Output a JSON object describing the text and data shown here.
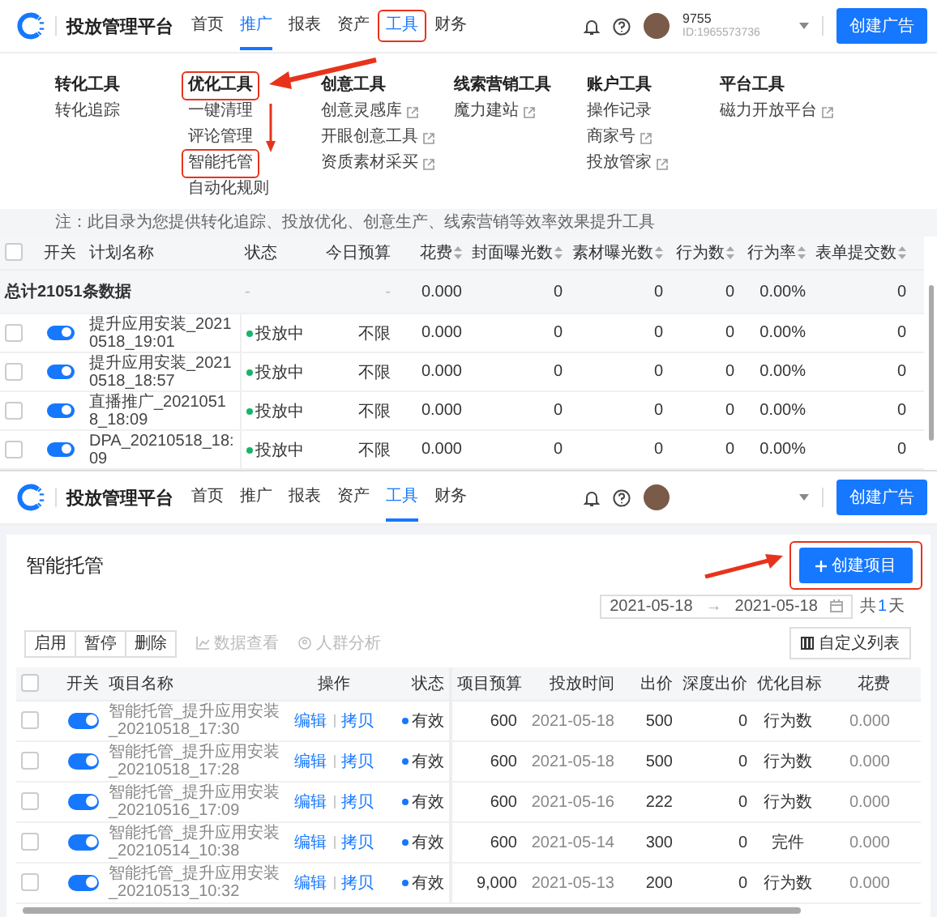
{
  "top_screen": {
    "nav": {
      "title": "投放管理平台",
      "tabs": [
        {
          "label": "首页",
          "selected": false,
          "highlighted": false
        },
        {
          "label": "推广",
          "selected": true,
          "highlighted": false
        },
        {
          "label": "报表",
          "selected": false,
          "highlighted": false
        },
        {
          "label": "资产",
          "selected": false,
          "highlighted": false
        },
        {
          "label": "工具",
          "selected": false,
          "highlighted": true
        },
        {
          "label": "财务",
          "selected": false,
          "highlighted": false
        }
      ],
      "user": {
        "name": "9755",
        "id": "ID:1965573736"
      },
      "create_button": "创建广告"
    },
    "menu": [
      {
        "heading": "转化工具",
        "highlighted": false,
        "items": [
          {
            "label": "转化追踪",
            "external": false,
            "highlighted": false
          }
        ]
      },
      {
        "heading": "优化工具",
        "highlighted": true,
        "items": [
          {
            "label": "一键清理",
            "external": false,
            "highlighted": false
          },
          {
            "label": "评论管理",
            "external": false,
            "highlighted": false
          },
          {
            "label": "智能托管",
            "external": false,
            "highlighted": true
          },
          {
            "label": "自动化规则",
            "external": false,
            "highlighted": false
          }
        ]
      },
      {
        "heading": "创意工具",
        "highlighted": false,
        "items": [
          {
            "label": "创意灵感库",
            "external": true,
            "highlighted": false
          },
          {
            "label": "开眼创意工具",
            "external": true,
            "highlighted": false
          },
          {
            "label": "资质素材采买",
            "external": true,
            "highlighted": false
          }
        ]
      },
      {
        "heading": "线索营销工具",
        "highlighted": false,
        "items": [
          {
            "label": "魔力建站",
            "external": true,
            "highlighted": false
          }
        ]
      },
      {
        "heading": "账户工具",
        "highlighted": false,
        "items": [
          {
            "label": "操作记录",
            "external": false,
            "highlighted": false
          },
          {
            "label": "商家号",
            "external": true,
            "highlighted": false
          },
          {
            "label": "投放管家",
            "external": true,
            "highlighted": false
          }
        ]
      },
      {
        "heading": "平台工具",
        "highlighted": false,
        "items": [
          {
            "label": "磁力开放平台",
            "external": true,
            "highlighted": false
          }
        ]
      }
    ],
    "note": "注：此目录为您提供转化追踪、投放优化、创意生产、线索营销等效率效果提升工具",
    "table": {
      "header_checked": false,
      "switch_header": "开关",
      "name_header": "计划名称",
      "status_header": "状态",
      "columns": [
        {
          "label": "今日预算",
          "sortable": false
        },
        {
          "label": "花费",
          "sortable": true
        },
        {
          "label": "封面曝光数",
          "sortable": true
        },
        {
          "label": "素材曝光数",
          "sortable": true
        },
        {
          "label": "行为数",
          "sortable": true
        },
        {
          "label": "行为率",
          "sortable": true
        },
        {
          "label": "表单提交数",
          "sortable": true
        }
      ],
      "total": {
        "label": "总计21051条数据",
        "status_cell": "-",
        "cells": [
          "-",
          "0.000",
          "0",
          "0",
          "0",
          "0.00%",
          "0"
        ]
      },
      "rows": [
        {
          "checked": false,
          "on": true,
          "name": "提升应用安装_20210518_19:01",
          "status": {
            "label": "投放中",
            "color": "#19b46b"
          },
          "cells": [
            "不限",
            "0.000",
            "0",
            "0",
            "0",
            "0.00%",
            "0"
          ]
        },
        {
          "checked": false,
          "on": true,
          "name": "提升应用安装_20210518_18:57",
          "status": {
            "label": "投放中",
            "color": "#19b46b"
          },
          "cells": [
            "不限",
            "0.000",
            "0",
            "0",
            "0",
            "0.00%",
            "0"
          ]
        },
        {
          "checked": false,
          "on": true,
          "name": "直播推广_20210518_18:09",
          "status": {
            "label": "投放中",
            "color": "#19b46b"
          },
          "cells": [
            "不限",
            "0.000",
            "0",
            "0",
            "0",
            "0.00%",
            "0"
          ]
        },
        {
          "checked": false,
          "on": true,
          "name": "DPA_20210518_18:09",
          "status": {
            "label": "投放中",
            "color": "#19b46b"
          },
          "cells": [
            "不限",
            "0.000",
            "0",
            "0",
            "0",
            "0.00%",
            "0"
          ]
        }
      ]
    }
  },
  "bottom_screen": {
    "nav": {
      "title": "投放管理平台",
      "tabs": [
        {
          "label": "首页",
          "selected": false,
          "highlighted": false
        },
        {
          "label": "推广",
          "selected": false,
          "highlighted": false
        },
        {
          "label": "报表",
          "selected": false,
          "highlighted": false
        },
        {
          "label": "资产",
          "selected": false,
          "highlighted": false
        },
        {
          "label": "工具",
          "selected": true,
          "highlighted": false
        },
        {
          "label": "财务",
          "selected": false,
          "highlighted": false
        }
      ],
      "create_button": "创建广告"
    },
    "title": "智能托管",
    "create_project_button": {
      "label": "创建项目",
      "highlighted": true
    },
    "date_range": {
      "start": "2021-05-18",
      "separator": "→",
      "end": "2021-05-18"
    },
    "day_count": {
      "prefix": "共",
      "value": "1",
      "suffix": "天"
    },
    "actions": [
      {
        "label": "启用"
      },
      {
        "label": "暂停"
      },
      {
        "label": "删除"
      }
    ],
    "links": [
      {
        "label": "数据查看",
        "kind": "chart",
        "disabled": true
      },
      {
        "label": "人群分析",
        "kind": "people",
        "disabled": true
      }
    ],
    "columns_button": "自定义列表",
    "table": {
      "header_checked": false,
      "switch_header": "开关",
      "name_header": "项目名称",
      "actions_header": "操作",
      "status_header": "状态",
      "columns": [
        "项目预算",
        "投放时间",
        "出价",
        "深度出价",
        "优化目标",
        "花费"
      ],
      "rows": [
        {
          "checked": false,
          "on": true,
          "name": "智能托管_提升应用安装_20210518_17:30",
          "actions": [
            "编辑",
            "拷贝"
          ],
          "status": {
            "label": "有效",
            "color": "#1677ff"
          },
          "cells": [
            "600",
            "2021-05-18",
            "500",
            "0",
            "行为数",
            "0.000"
          ]
        },
        {
          "checked": false,
          "on": true,
          "name": "智能托管_提升应用安装_20210518_17:28",
          "actions": [
            "编辑",
            "拷贝"
          ],
          "status": {
            "label": "有效",
            "color": "#1677ff"
          },
          "cells": [
            "600",
            "2021-05-18",
            "500",
            "0",
            "行为数",
            "0.000"
          ]
        },
        {
          "checked": false,
          "on": true,
          "name": "智能托管_提升应用安装_20210516_17:09",
          "actions": [
            "编辑",
            "拷贝"
          ],
          "status": {
            "label": "有效",
            "color": "#1677ff"
          },
          "cells": [
            "600",
            "2021-05-16",
            "222",
            "0",
            "行为数",
            "0.000"
          ]
        },
        {
          "checked": false,
          "on": true,
          "name": "智能托管_提升应用安装_20210514_10:38",
          "actions": [
            "编辑",
            "拷贝"
          ],
          "status": {
            "label": "有效",
            "color": "#1677ff"
          },
          "cells": [
            "600",
            "2021-05-14",
            "300",
            "0",
            "完件",
            "0.000"
          ]
        },
        {
          "checked": false,
          "on": true,
          "name": "智能托管_提升应用安装_20210513_10:32",
          "actions": [
            "编辑",
            "拷贝"
          ],
          "status": {
            "label": "有效",
            "color": "#1677ff"
          },
          "cells": [
            "9,000",
            "2021-05-13",
            "200",
            "0",
            "行为数",
            "0.000"
          ]
        }
      ]
    }
  }
}
